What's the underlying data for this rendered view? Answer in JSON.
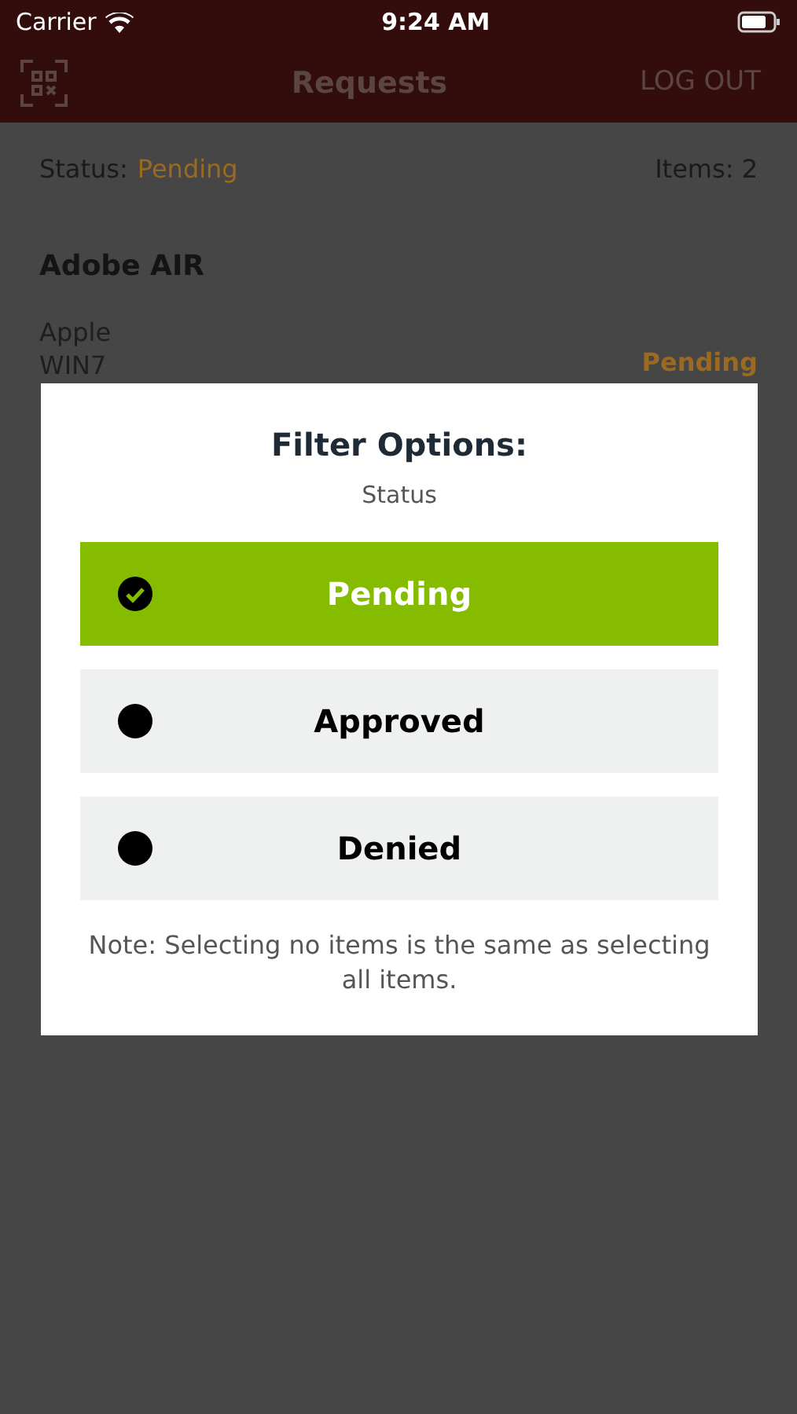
{
  "status_bar": {
    "carrier": "Carrier",
    "time": "9:24 AM"
  },
  "nav": {
    "title": "Requests",
    "action": "LOG OUT"
  },
  "summary": {
    "status_label": "Status:",
    "status_value": "Pending",
    "count": "Items: 2"
  },
  "requests": [
    {
      "name": "Adobe AIR",
      "vendor": "Apple",
      "platform": "WIN7",
      "status": "Pending"
    }
  ],
  "dialog": {
    "title": "Filter Options:",
    "subtitle": "Status",
    "options": [
      {
        "label": "Pending",
        "selected": true
      },
      {
        "label": "Approved",
        "selected": false
      },
      {
        "label": "Denied",
        "selected": false
      }
    ],
    "note": "Note: Selecting no items is the same as selecting all items."
  }
}
